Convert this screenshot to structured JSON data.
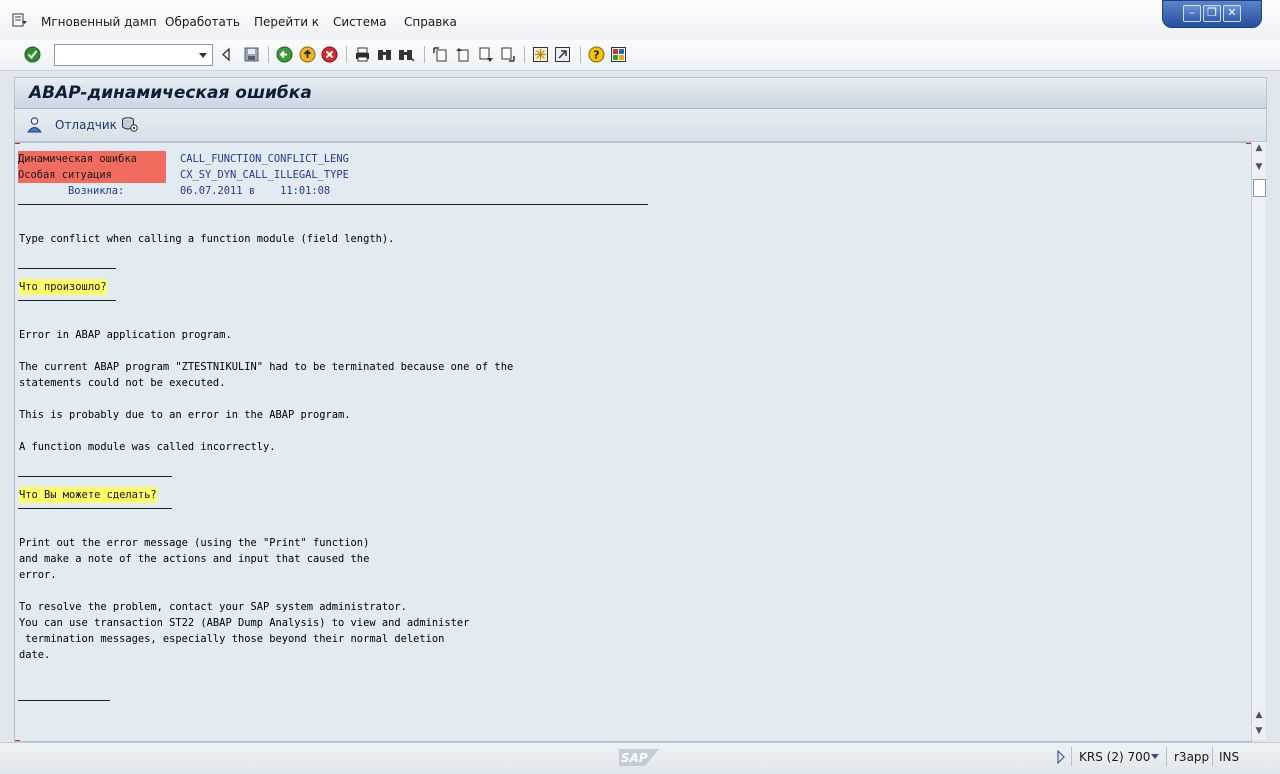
{
  "menu": {
    "items": [
      "Мгновенный дамп",
      "Обработать",
      "Перейти к",
      "Система",
      "Справка"
    ]
  },
  "toolbar": {
    "command_field_value": "",
    "icons": [
      "enter-icon",
      "back-nav-icon",
      "save-icon",
      "back-icon",
      "exit-icon",
      "cancel-icon",
      "print-icon",
      "find-icon",
      "find-next-icon",
      "first-page-icon",
      "prev-page-icon",
      "next-page-icon",
      "last-page-icon",
      "create-session-icon",
      "shortcut-icon",
      "help-icon",
      "customize-layout-icon"
    ]
  },
  "title": "ABAP-динамическая ошибка",
  "app_toolbar": {
    "debugger_label": "Отладчик"
  },
  "dump": {
    "error_label": "Динамическая ошибка",
    "error_value": "CALL_FUNCTION_CONFLICT_LENG",
    "exception_label": "Особая ситуация",
    "exception_value": "CX_SY_DYN_CALL_ILLEGAL_TYPE",
    "occurred_label": "Возникла:",
    "occurred_value": "06.07.2011 в    11:01:08",
    "short_text": "Type conflict when calling a function module (field length).",
    "what_happened_heading": "Что произошло?",
    "what_happened_lines": [
      "Error in ABAP application program.",
      "",
      "The current ABAP program \"ZTESTNIKULIN\" had to be terminated because one of the",
      "statements could not be executed.",
      "",
      "This is probably due to an error in the ABAP program.",
      "",
      "A function module was called incorrectly."
    ],
    "what_can_you_do_heading": "Что Вы можете сделать?",
    "what_can_you_do_lines": [
      "Print out the error message (using the \"Print\" function)",
      "and make a note of the actions and input that caused the",
      "error.",
      "",
      "To resolve the problem, contact your SAP system administrator.",
      "You can use transaction ST22 (ABAP Dump Analysis) to view and administer",
      " termination messages, especially those beyond their normal deletion",
      "date."
    ]
  },
  "statusbar": {
    "system": "KRS (2) 700",
    "server": "r3app",
    "mode": "INS"
  },
  "colors": {
    "red_label": "#f26b5f",
    "yellow_label": "#ffff66",
    "content_bg": "#e3ebf2"
  }
}
